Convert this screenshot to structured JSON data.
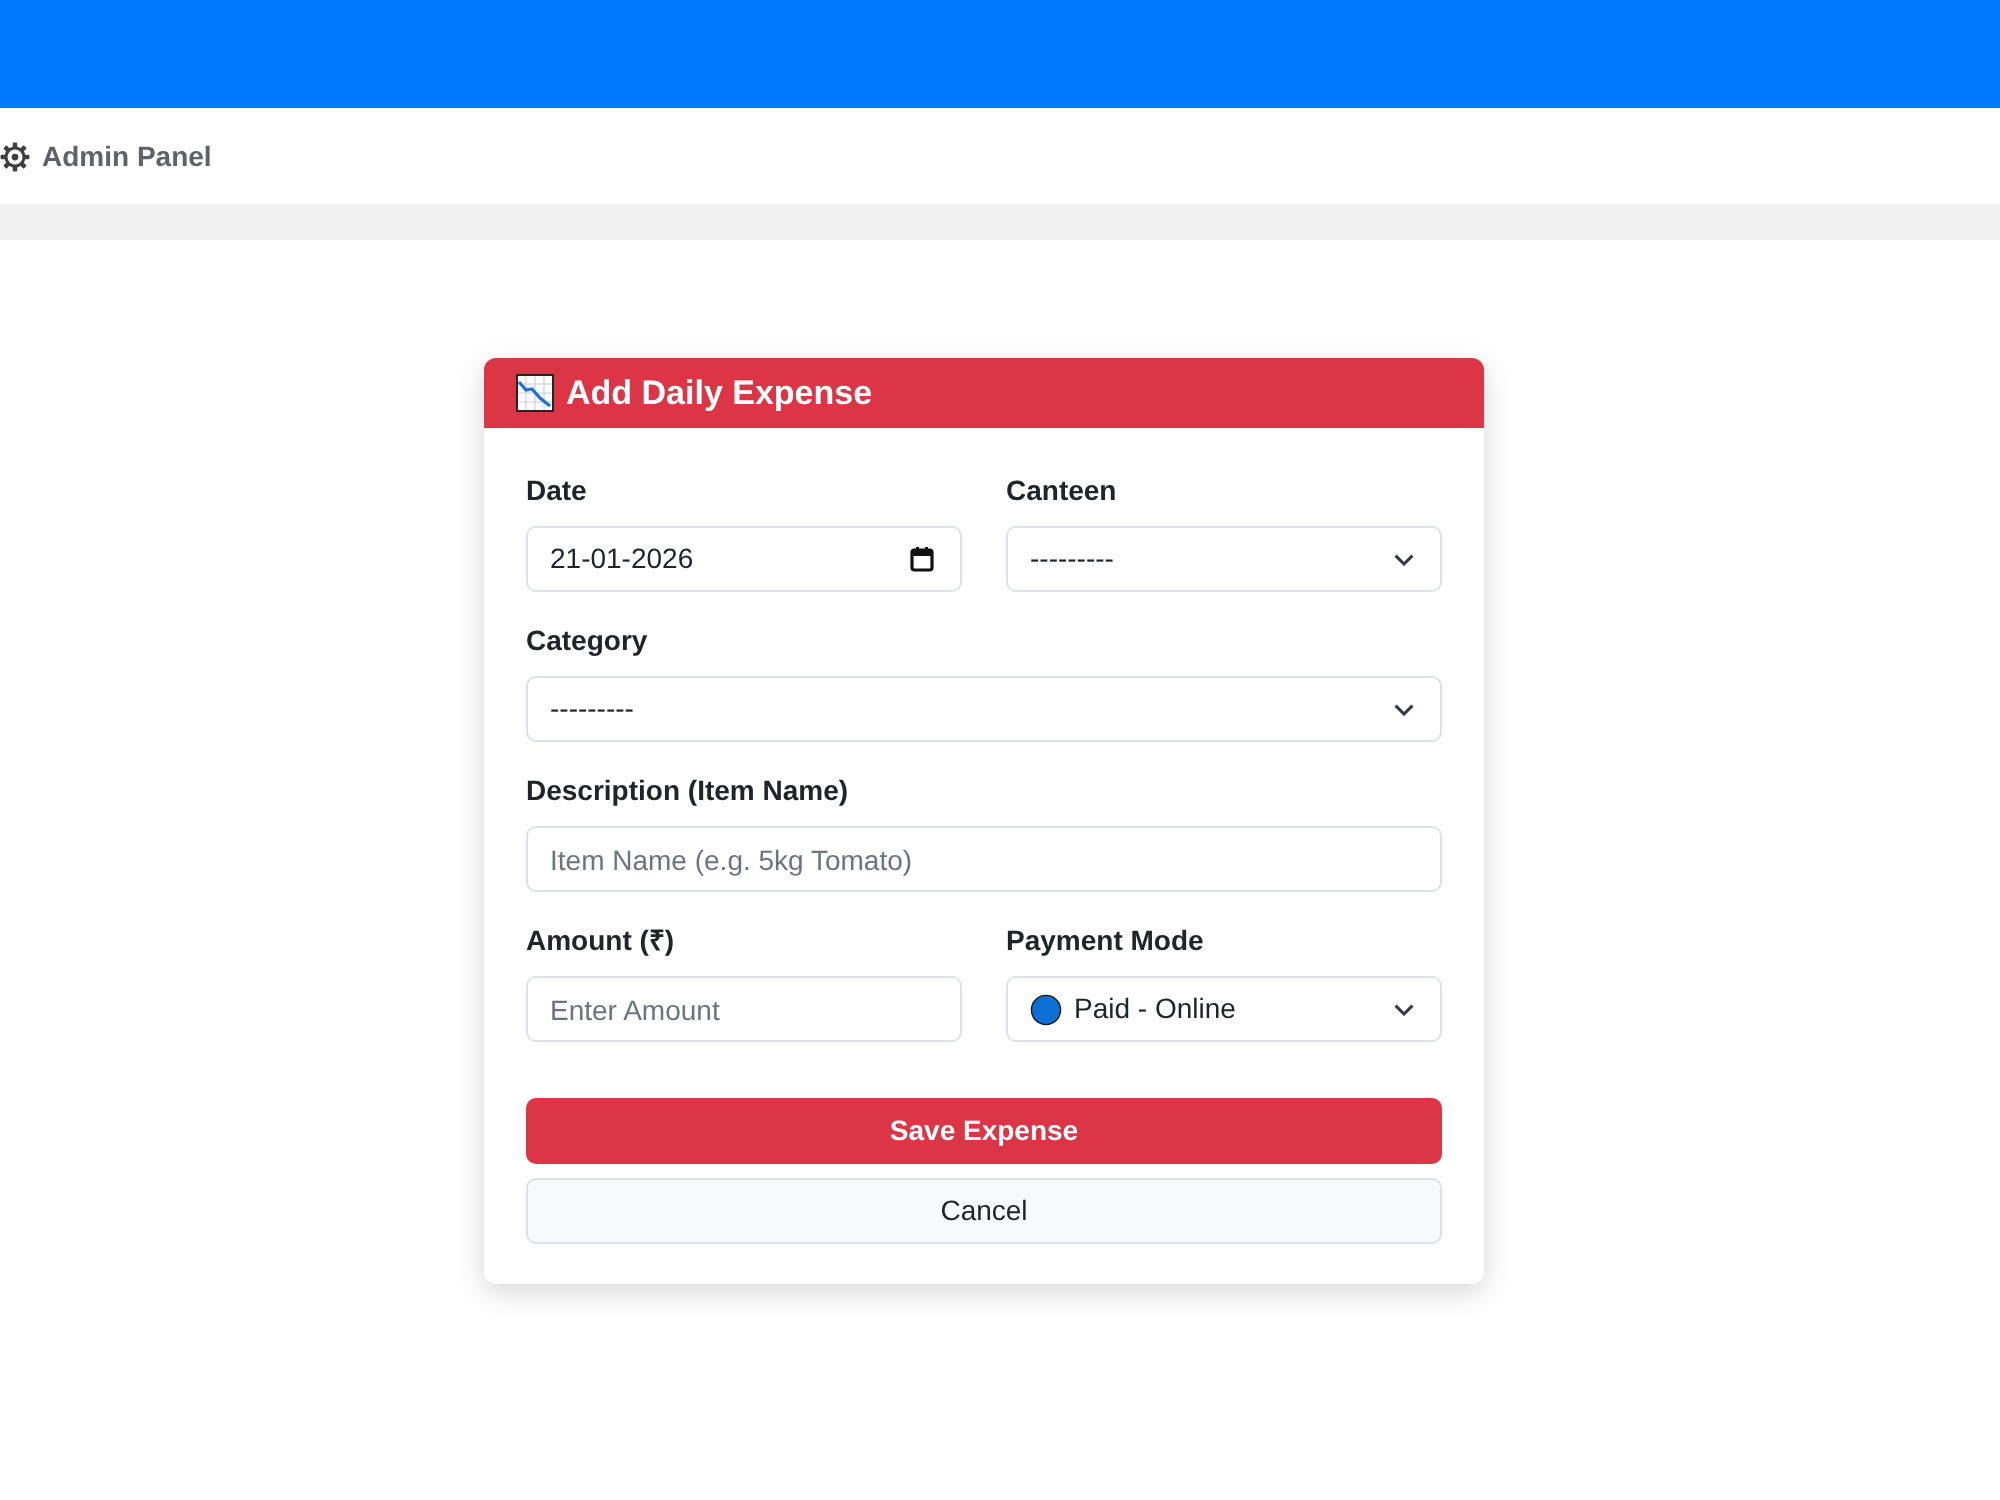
{
  "navbar": {
    "brand": "Admin Panel"
  },
  "form": {
    "title": "Add Daily Expense",
    "rows": [
      [
        {
          "label": "Date",
          "kind": "date",
          "value": "21-01-2026"
        },
        {
          "label": "Canteen",
          "kind": "select",
          "value": "---------"
        }
      ],
      [
        {
          "label": "Category",
          "kind": "select",
          "value": "---------"
        }
      ],
      [
        {
          "label": "Description (Item Name)",
          "kind": "text",
          "placeholder": "Item Name (e.g. 5kg Tomato)"
        }
      ],
      [
        {
          "label": "Amount (₹)",
          "kind": "text",
          "placeholder": "Enter Amount"
        },
        {
          "label": "Payment Mode",
          "kind": "select",
          "value": "Paid - Online",
          "color": "#0b6fd6"
        }
      ]
    ],
    "buttons": [
      {
        "label": "Save Expense",
        "kind": "primary"
      },
      {
        "label": "Cancel",
        "kind": "secondary"
      }
    ]
  }
}
